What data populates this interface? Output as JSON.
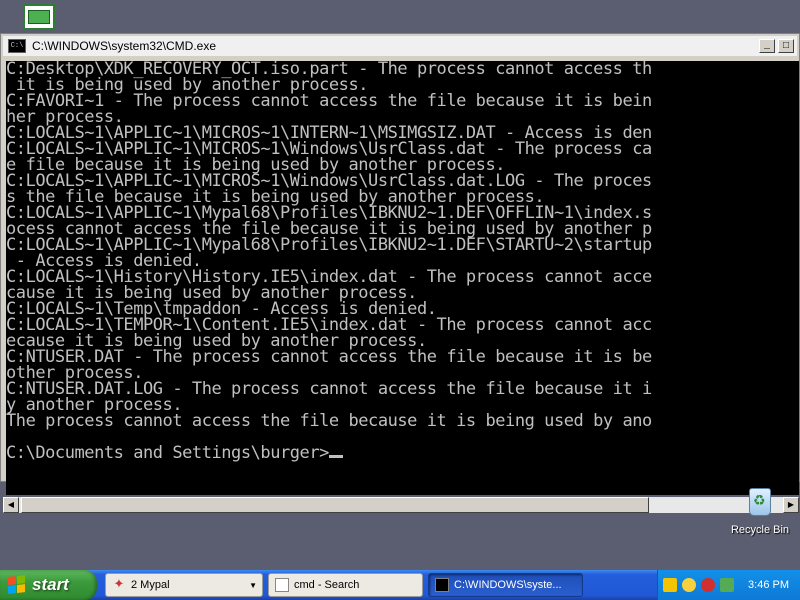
{
  "window": {
    "title": "C:\\WINDOWS\\system32\\CMD.exe",
    "console_lines": [
      "C:Desktop\\XDK_RECOVERY_OCT.iso.part - The process cannot access th",
      " it is being used by another process.",
      "C:FAVORI~1 - The process cannot access the file because it is bein",
      "her process.",
      "C:LOCALS~1\\APPLIC~1\\MICROS~1\\INTERN~1\\MSIMGSIZ.DAT - Access is den",
      "C:LOCALS~1\\APPLIC~1\\MICROS~1\\Windows\\UsrClass.dat - The process ca",
      "e file because it is being used by another process.",
      "C:LOCALS~1\\APPLIC~1\\MICROS~1\\Windows\\UsrClass.dat.LOG - The proces",
      "s the file because it is being used by another process.",
      "C:LOCALS~1\\APPLIC~1\\Mypal68\\Profiles\\IBKNU2~1.DEF\\OFFLIN~1\\index.s",
      "ocess cannot access the file because it is being used by another p",
      "C:LOCALS~1\\APPLIC~1\\Mypal68\\Profiles\\IBKNU2~1.DEF\\STARTU~2\\startup",
      " - Access is denied.",
      "C:LOCALS~1\\History\\History.IE5\\index.dat - The process cannot acce",
      "cause it is being used by another process.",
      "C:LOCALS~1\\Temp\\tmpaddon - Access is denied.",
      "C:LOCALS~1\\TEMPOR~1\\Content.IE5\\index.dat - The process cannot acc",
      "ecause it is being used by another process.",
      "C:NTUSER.DAT - The process cannot access the file because it is be",
      "other process.",
      "C:NTUSER.DAT.LOG - The process cannot access the file because it i",
      "y another process.",
      "The process cannot access the file because it is being used by ano",
      "",
      "C:\\Documents and Settings\\burger>"
    ],
    "controls": {
      "system_icon": "C:\\",
      "minimize": "_",
      "maximize": "□"
    }
  },
  "desktop": {
    "recycle_bin_label": "Recycle Bin"
  },
  "taskbar": {
    "start_label": "start",
    "tasks": [
      {
        "label": "2 Mypal",
        "icon": "mypal-icon"
      },
      {
        "label": "cmd - Search",
        "icon": "search-icon"
      },
      {
        "label": "C:\\WINDOWS\\syste...",
        "icon": "cmd-icon"
      }
    ],
    "tray_icons": [
      "shield-icon",
      "security-alert-icon",
      "antivirus-icon",
      "network-icon"
    ],
    "clock": "3:46 PM"
  },
  "colors": {
    "console_bg": "#000000",
    "console_text": "#c0c0c0",
    "desktop_bg": "#5a5e70",
    "taskbar_blue": "#245edb",
    "start_green": "#3c9a3c"
  }
}
